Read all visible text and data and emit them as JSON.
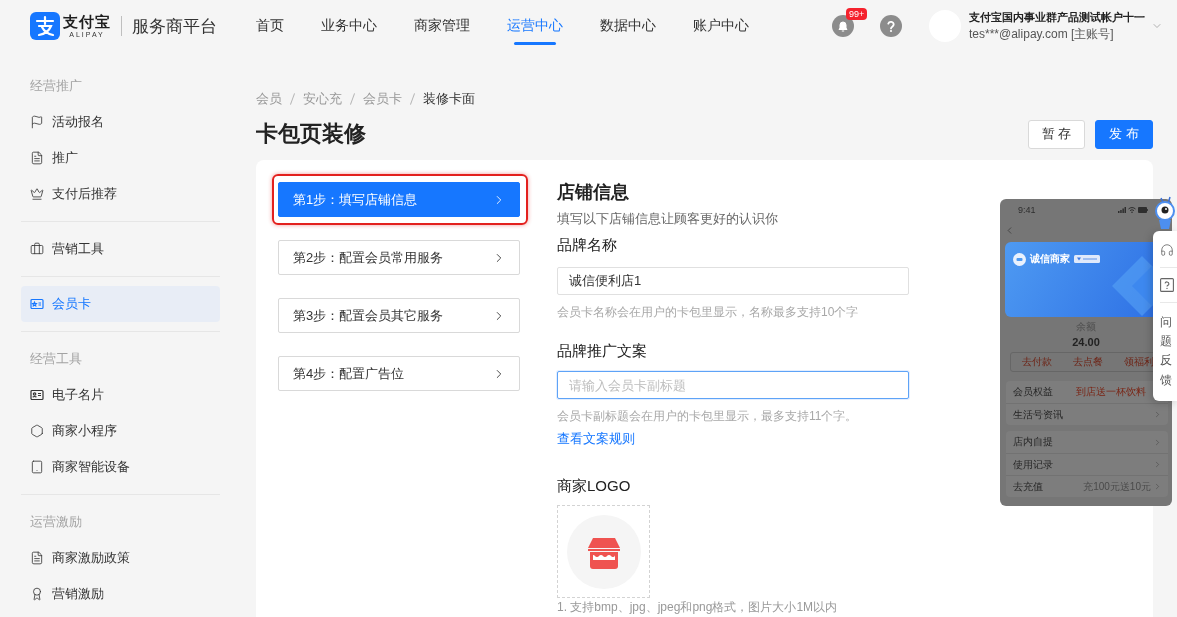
{
  "header": {
    "logo": {
      "brand": "支付宝",
      "brand_en": "ALIPAY",
      "platform": "服务商平台"
    },
    "nav": [
      {
        "label": "首页",
        "selected": false
      },
      {
        "label": "业务中心",
        "selected": false
      },
      {
        "label": "商家管理",
        "selected": false
      },
      {
        "label": "运营中心",
        "selected": true
      },
      {
        "label": "数据中心",
        "selected": false
      },
      {
        "label": "账户中心",
        "selected": false
      }
    ],
    "notification_badge": "99+",
    "user": {
      "name": "支付宝国内事业群产品测试帐户十一",
      "account": "tes***@alipay.com [主账号]"
    }
  },
  "sidebar": {
    "sections": [
      {
        "title": "经营推广",
        "items": [
          {
            "label": "活动报名",
            "selected": false
          },
          {
            "label": "推广",
            "selected": false
          },
          {
            "label": "支付后推荐",
            "selected": false
          }
        ]
      },
      {
        "items": [
          {
            "label": "营销工具",
            "selected": false
          }
        ]
      },
      {
        "items": [
          {
            "label": "会员卡",
            "selected": true
          }
        ]
      },
      {
        "title": "经营工具",
        "items": [
          {
            "label": "电子名片",
            "selected": false
          },
          {
            "label": "商家小程序",
            "selected": false
          },
          {
            "label": "商家智能设备",
            "selected": false
          }
        ]
      },
      {
        "title": "运营激励",
        "items": [
          {
            "label": "商家激励政策",
            "selected": false
          },
          {
            "label": "营销激励",
            "selected": false
          }
        ]
      }
    ]
  },
  "breadcrumb": [
    {
      "label": "会员",
      "current": false
    },
    {
      "label": "安心充",
      "current": false
    },
    {
      "label": "会员卡",
      "current": false
    },
    {
      "label": "装修卡面",
      "current": true
    }
  ],
  "page_title": "卡包页装修",
  "actions": [
    {
      "label": "暂 存",
      "kind": "secondary"
    },
    {
      "label": "发 布",
      "kind": "primary"
    }
  ],
  "steps": [
    {
      "label": "第1步：填写店铺信息",
      "selected": true,
      "highlighted": true
    },
    {
      "label": "第2步：配置会员常用服务",
      "selected": false,
      "highlighted": false
    },
    {
      "label": "第3步：配置会员其它服务",
      "selected": false,
      "highlighted": false
    },
    {
      "label": "第4步：配置广告位",
      "selected": false,
      "highlighted": false
    }
  ],
  "form": {
    "title": "店铺信息",
    "subtitle": "填写以下店铺信息让顾客更好的认识你",
    "fields": [
      {
        "label": "品牌名称",
        "value": "诚信便利店1",
        "hint": "会员卡名称会在用户的卡包里显示，名称最多支持10个字",
        "focused": false
      },
      {
        "label": "品牌推广文案",
        "placeholder": "请输入会员卡副标题",
        "hint": "会员卡副标题会在用户的卡包里显示，最多支持11个字。",
        "link": "查看文案规则",
        "focused": true
      }
    ],
    "logo": {
      "label": "商家LOGO",
      "note": "1. 支持bmp、jpg、jpeg和png格式，图片大小1M以内"
    }
  },
  "preview": {
    "time": "9:41",
    "merchant": "诚信商家",
    "balance_label": "余额",
    "balance": "24.00",
    "actions": [
      "去付款",
      "去点餐",
      "领福利"
    ],
    "groups": [
      {
        "rows": [
          {
            "label": "会员权益",
            "detail": {
              "text": "到店送一杯饮料",
              "highlight": true
            },
            "arrow": false
          },
          {
            "label": "生活号资讯",
            "arrow": true
          }
        ]
      },
      {
        "rows": [
          {
            "label": "店内自提",
            "arrow": true
          },
          {
            "label": "使用记录",
            "arrow": true
          },
          {
            "label": "去充值",
            "detail": {
              "text": "充100元送10元",
              "highlight": false
            },
            "arrow": true
          }
        ]
      }
    ]
  },
  "help_widget": {
    "label": "问题反馈"
  }
}
